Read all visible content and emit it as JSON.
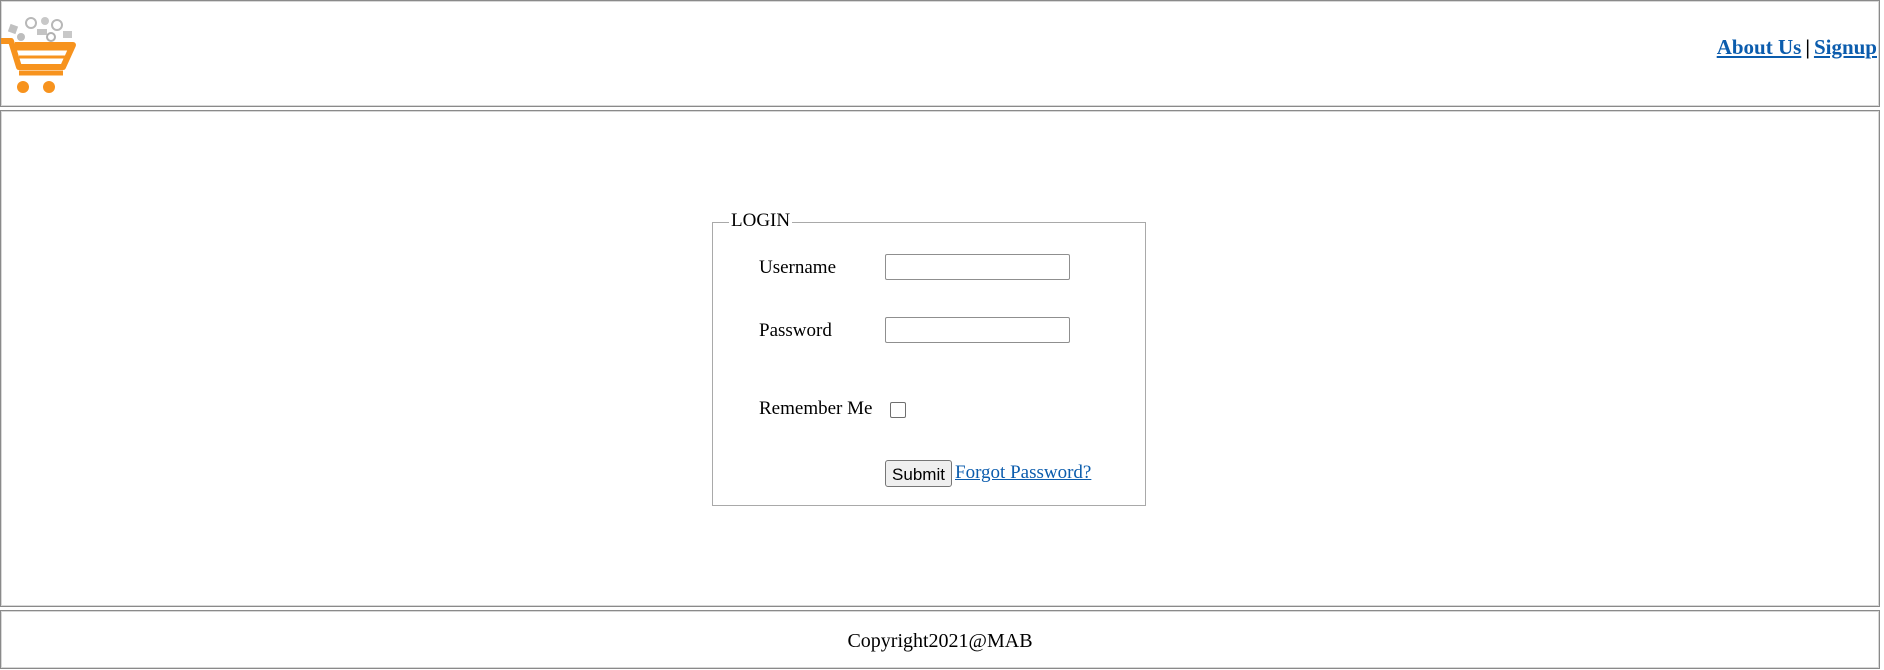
{
  "header": {
    "logo_icon": "shopping-cart-logo",
    "nav_links": [
      "About Us",
      "Signup"
    ],
    "separator": "|"
  },
  "login": {
    "legend": "LOGIN",
    "username_label": "Username",
    "username_value": "",
    "password_label": "Password",
    "password_value": "",
    "remember_label": "Remember Me",
    "remember_checked": false,
    "submit_label": "Submit",
    "forgot_label": "Forgot Password?"
  },
  "footer": {
    "copyright": "Copyright2021@MAB"
  },
  "colors": {
    "link": "#0b5cad",
    "logo_orange": "#f7931e",
    "logo_gray": "#b8b8b8"
  }
}
